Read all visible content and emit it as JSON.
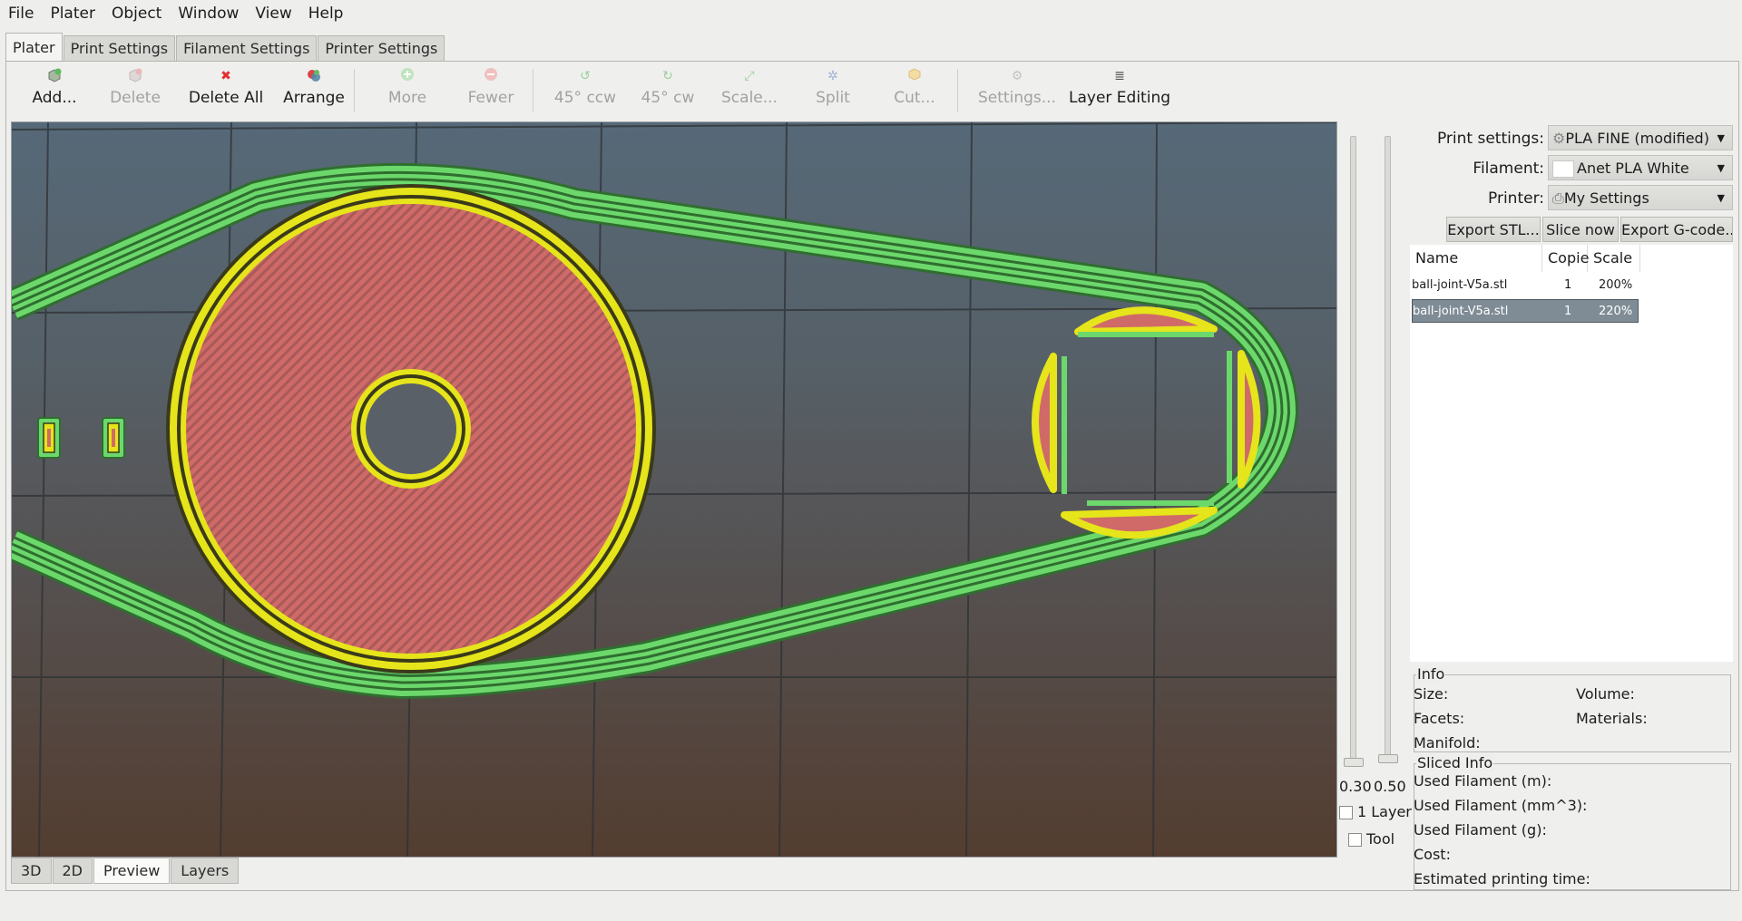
{
  "menu": [
    "File",
    "Plater",
    "Object",
    "Window",
    "View",
    "Help"
  ],
  "tabs": [
    "Plater",
    "Print Settings",
    "Filament Settings",
    "Printer Settings"
  ],
  "toolbar": {
    "add": "Add...",
    "delete": "Delete",
    "delete_all": "Delete All",
    "arrange": "Arrange",
    "more": "More",
    "fewer": "Fewer",
    "rotate_ccw": "45° ccw",
    "rotate_cw": "45° cw",
    "scale": "Scale...",
    "split": "Split",
    "cut": "Cut...",
    "settings": "Settings...",
    "layer_editing": "Layer Editing"
  },
  "layers": {
    "min_value": "0.30",
    "max_value": "0.50",
    "one_layer_label": "1 Layer",
    "tool_label": "Tool"
  },
  "view_tabs": [
    "3D",
    "2D",
    "Preview",
    "Layers"
  ],
  "right": {
    "print_settings_label": "Print settings:",
    "print_settings_value": "PLA FINE (modified)",
    "filament_label": "Filament:",
    "filament_value": "Anet PLA White",
    "printer_label": "Printer:",
    "printer_value": "My Settings",
    "export_stl": "Export STL...",
    "slice_now": "Slice now",
    "export_gcode": "Export G-code..."
  },
  "object_list": {
    "headers": [
      "Name",
      "Copie",
      "Scale"
    ],
    "rows": [
      {
        "name": "ball-joint-V5a.stl",
        "copies": "1",
        "scale": "200%"
      },
      {
        "name": "ball-joint-V5a.stl",
        "copies": "1",
        "scale": "220%"
      }
    ]
  },
  "info": {
    "title": "Info",
    "size": "Size:",
    "volume": "Volume:",
    "facets": "Facets:",
    "materials": "Materials:",
    "manifold": "Manifold:"
  },
  "sliced_info": {
    "title": "Sliced Info",
    "used_m": "Used Filament (m):",
    "used_mm3": "Used Filament (mm^3):",
    "used_g": "Used Filament (g):",
    "cost": "Cost:",
    "time": "Estimated printing time:"
  },
  "colors": {
    "perimeter_green": "#6cd86c",
    "outer_yellow": "#e6e41a",
    "infill_red": "#d46a6a",
    "selected_row": "#7f8c96"
  }
}
